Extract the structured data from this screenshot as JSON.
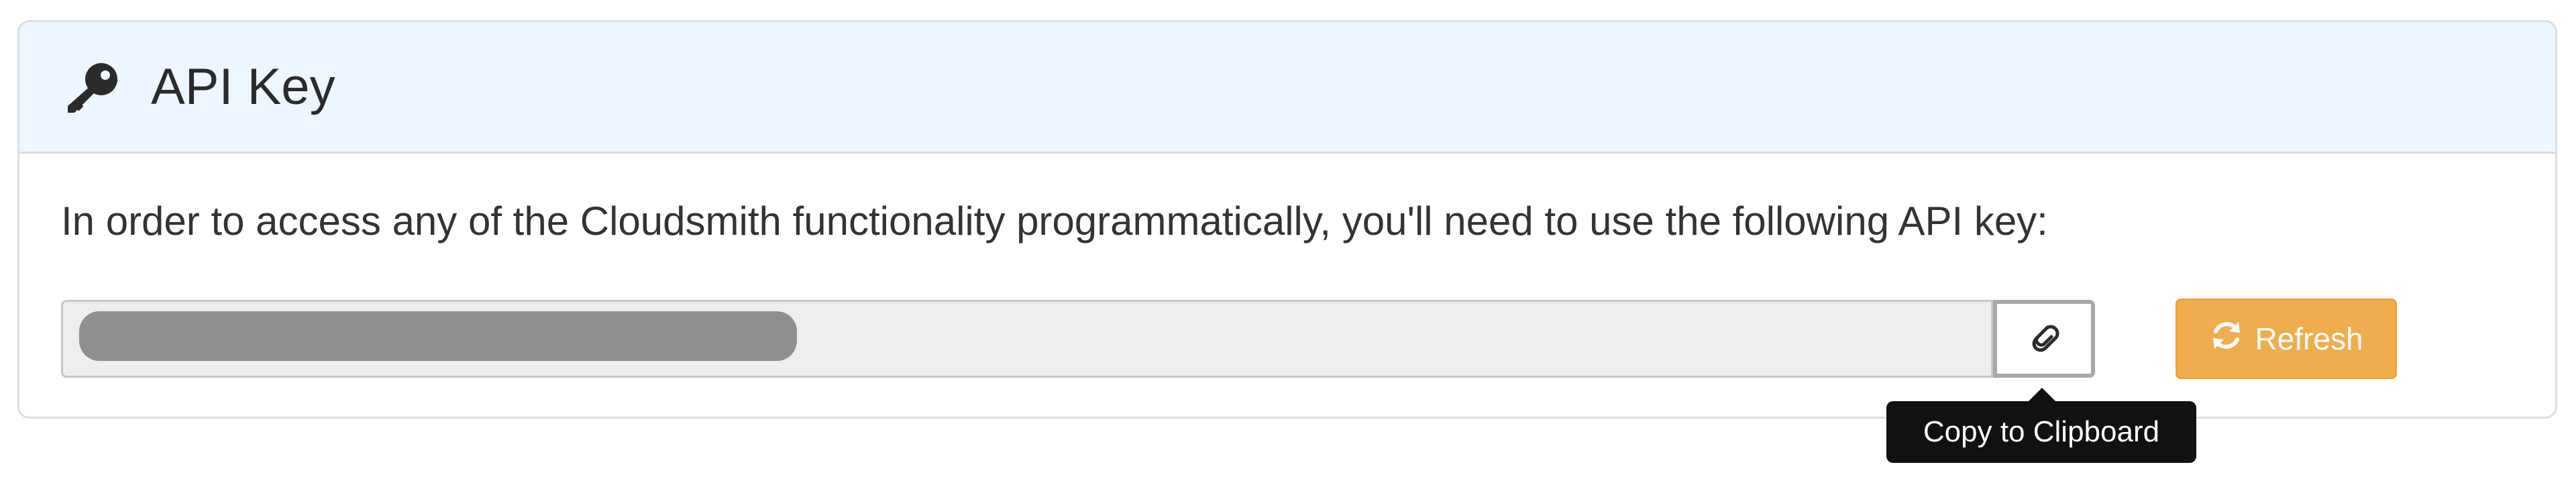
{
  "panel": {
    "title": "API Key",
    "title_icon": "key-icon",
    "description": "In order to access any of the Cloudsmith functionality programmatically, you'll need to use the following API key:"
  },
  "api_key_field": {
    "value_masked": true
  },
  "copy_button": {
    "icon": "paperclip-icon",
    "tooltip": "Copy to Clipboard"
  },
  "refresh_button": {
    "label": "Refresh",
    "icon": "refresh-icon",
    "color": "#f0ad4e"
  },
  "colors": {
    "header_bg": "#eef6ff",
    "border": "#d9dfe6",
    "tooltip_bg": "#111111"
  }
}
